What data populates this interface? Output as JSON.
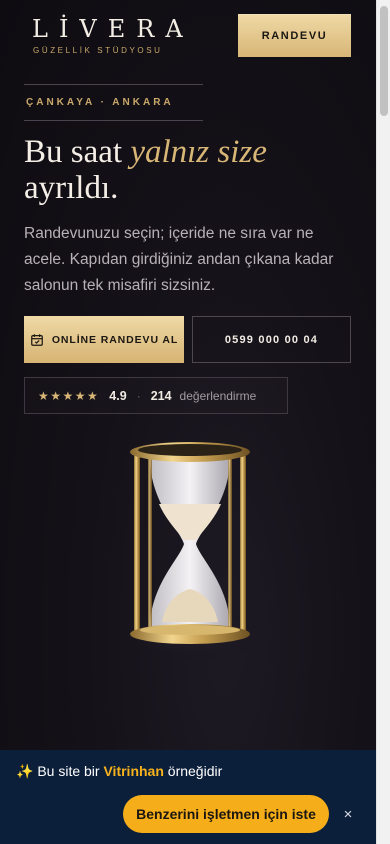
{
  "brand": {
    "name": "LİVERA",
    "tagline": "GÜZELLİK STÜDYOSU"
  },
  "header": {
    "cta_label": "RANDEVU"
  },
  "hero": {
    "location": "ÇANKAYA · ANKARA",
    "headline_start": "Bu saat ",
    "headline_accent": "yalnız size",
    "headline_end": "ayrıldı.",
    "lede": "Randevunuzu seçin; içeride ne sıra var ne acele. Kapıdan girdiğiniz andan çıkana kadar salonun tek misafiri sizsiniz.",
    "primary_cta": "ONLİNE RANDEVU AL",
    "phone_cta": "0599 000 00 04"
  },
  "rating": {
    "stars": "★★★★★",
    "score": "4.9",
    "separator": "·",
    "count": "214",
    "count_label": "değerlendirme"
  },
  "banner": {
    "emoji": "✨",
    "prefix": "Bu site bir ",
    "brand": "Vitrinhan",
    "suffix": " örneğidir",
    "cta": "Benzerini işletmen için iste",
    "close": "×"
  },
  "colors": {
    "gold": "#d8b676",
    "background": "#0f0d12",
    "banner": "#0c1f3a",
    "banner_accent": "#f5ae1a"
  }
}
